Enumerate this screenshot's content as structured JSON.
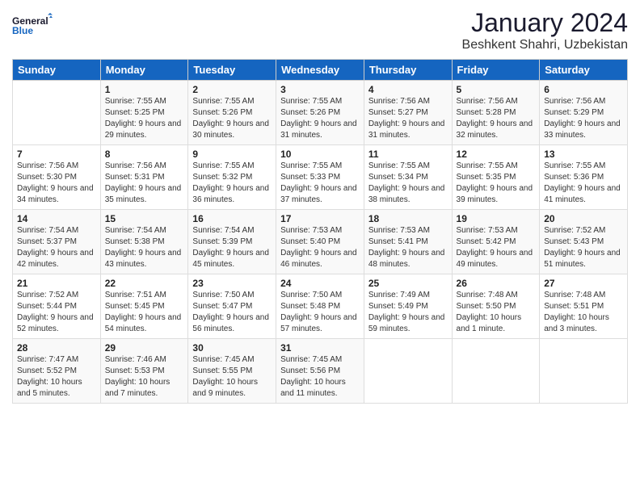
{
  "logo": {
    "line1": "General",
    "line2": "Blue"
  },
  "title": "January 2024",
  "location": "Beshkent Shahri, Uzbekistan",
  "days_of_week": [
    "Sunday",
    "Monday",
    "Tuesday",
    "Wednesday",
    "Thursday",
    "Friday",
    "Saturday"
  ],
  "weeks": [
    [
      {
        "day": "",
        "sunrise": "",
        "sunset": "",
        "daylight": ""
      },
      {
        "day": "1",
        "sunrise": "Sunrise: 7:55 AM",
        "sunset": "Sunset: 5:25 PM",
        "daylight": "Daylight: 9 hours and 29 minutes."
      },
      {
        "day": "2",
        "sunrise": "Sunrise: 7:55 AM",
        "sunset": "Sunset: 5:26 PM",
        "daylight": "Daylight: 9 hours and 30 minutes."
      },
      {
        "day": "3",
        "sunrise": "Sunrise: 7:55 AM",
        "sunset": "Sunset: 5:26 PM",
        "daylight": "Daylight: 9 hours and 31 minutes."
      },
      {
        "day": "4",
        "sunrise": "Sunrise: 7:56 AM",
        "sunset": "Sunset: 5:27 PM",
        "daylight": "Daylight: 9 hours and 31 minutes."
      },
      {
        "day": "5",
        "sunrise": "Sunrise: 7:56 AM",
        "sunset": "Sunset: 5:28 PM",
        "daylight": "Daylight: 9 hours and 32 minutes."
      },
      {
        "day": "6",
        "sunrise": "Sunrise: 7:56 AM",
        "sunset": "Sunset: 5:29 PM",
        "daylight": "Daylight: 9 hours and 33 minutes."
      }
    ],
    [
      {
        "day": "7",
        "sunrise": "Sunrise: 7:56 AM",
        "sunset": "Sunset: 5:30 PM",
        "daylight": "Daylight: 9 hours and 34 minutes."
      },
      {
        "day": "8",
        "sunrise": "Sunrise: 7:56 AM",
        "sunset": "Sunset: 5:31 PM",
        "daylight": "Daylight: 9 hours and 35 minutes."
      },
      {
        "day": "9",
        "sunrise": "Sunrise: 7:55 AM",
        "sunset": "Sunset: 5:32 PM",
        "daylight": "Daylight: 9 hours and 36 minutes."
      },
      {
        "day": "10",
        "sunrise": "Sunrise: 7:55 AM",
        "sunset": "Sunset: 5:33 PM",
        "daylight": "Daylight: 9 hours and 37 minutes."
      },
      {
        "day": "11",
        "sunrise": "Sunrise: 7:55 AM",
        "sunset": "Sunset: 5:34 PM",
        "daylight": "Daylight: 9 hours and 38 minutes."
      },
      {
        "day": "12",
        "sunrise": "Sunrise: 7:55 AM",
        "sunset": "Sunset: 5:35 PM",
        "daylight": "Daylight: 9 hours and 39 minutes."
      },
      {
        "day": "13",
        "sunrise": "Sunrise: 7:55 AM",
        "sunset": "Sunset: 5:36 PM",
        "daylight": "Daylight: 9 hours and 41 minutes."
      }
    ],
    [
      {
        "day": "14",
        "sunrise": "Sunrise: 7:54 AM",
        "sunset": "Sunset: 5:37 PM",
        "daylight": "Daylight: 9 hours and 42 minutes."
      },
      {
        "day": "15",
        "sunrise": "Sunrise: 7:54 AM",
        "sunset": "Sunset: 5:38 PM",
        "daylight": "Daylight: 9 hours and 43 minutes."
      },
      {
        "day": "16",
        "sunrise": "Sunrise: 7:54 AM",
        "sunset": "Sunset: 5:39 PM",
        "daylight": "Daylight: 9 hours and 45 minutes."
      },
      {
        "day": "17",
        "sunrise": "Sunrise: 7:53 AM",
        "sunset": "Sunset: 5:40 PM",
        "daylight": "Daylight: 9 hours and 46 minutes."
      },
      {
        "day": "18",
        "sunrise": "Sunrise: 7:53 AM",
        "sunset": "Sunset: 5:41 PM",
        "daylight": "Daylight: 9 hours and 48 minutes."
      },
      {
        "day": "19",
        "sunrise": "Sunrise: 7:53 AM",
        "sunset": "Sunset: 5:42 PM",
        "daylight": "Daylight: 9 hours and 49 minutes."
      },
      {
        "day": "20",
        "sunrise": "Sunrise: 7:52 AM",
        "sunset": "Sunset: 5:43 PM",
        "daylight": "Daylight: 9 hours and 51 minutes."
      }
    ],
    [
      {
        "day": "21",
        "sunrise": "Sunrise: 7:52 AM",
        "sunset": "Sunset: 5:44 PM",
        "daylight": "Daylight: 9 hours and 52 minutes."
      },
      {
        "day": "22",
        "sunrise": "Sunrise: 7:51 AM",
        "sunset": "Sunset: 5:45 PM",
        "daylight": "Daylight: 9 hours and 54 minutes."
      },
      {
        "day": "23",
        "sunrise": "Sunrise: 7:50 AM",
        "sunset": "Sunset: 5:47 PM",
        "daylight": "Daylight: 9 hours and 56 minutes."
      },
      {
        "day": "24",
        "sunrise": "Sunrise: 7:50 AM",
        "sunset": "Sunset: 5:48 PM",
        "daylight": "Daylight: 9 hours and 57 minutes."
      },
      {
        "day": "25",
        "sunrise": "Sunrise: 7:49 AM",
        "sunset": "Sunset: 5:49 PM",
        "daylight": "Daylight: 9 hours and 59 minutes."
      },
      {
        "day": "26",
        "sunrise": "Sunrise: 7:48 AM",
        "sunset": "Sunset: 5:50 PM",
        "daylight": "Daylight: 10 hours and 1 minute."
      },
      {
        "day": "27",
        "sunrise": "Sunrise: 7:48 AM",
        "sunset": "Sunset: 5:51 PM",
        "daylight": "Daylight: 10 hours and 3 minutes."
      }
    ],
    [
      {
        "day": "28",
        "sunrise": "Sunrise: 7:47 AM",
        "sunset": "Sunset: 5:52 PM",
        "daylight": "Daylight: 10 hours and 5 minutes."
      },
      {
        "day": "29",
        "sunrise": "Sunrise: 7:46 AM",
        "sunset": "Sunset: 5:53 PM",
        "daylight": "Daylight: 10 hours and 7 minutes."
      },
      {
        "day": "30",
        "sunrise": "Sunrise: 7:45 AM",
        "sunset": "Sunset: 5:55 PM",
        "daylight": "Daylight: 10 hours and 9 minutes."
      },
      {
        "day": "31",
        "sunrise": "Sunrise: 7:45 AM",
        "sunset": "Sunset: 5:56 PM",
        "daylight": "Daylight: 10 hours and 11 minutes."
      },
      {
        "day": "",
        "sunrise": "",
        "sunset": "",
        "daylight": ""
      },
      {
        "day": "",
        "sunrise": "",
        "sunset": "",
        "daylight": ""
      },
      {
        "day": "",
        "sunrise": "",
        "sunset": "",
        "daylight": ""
      }
    ]
  ]
}
